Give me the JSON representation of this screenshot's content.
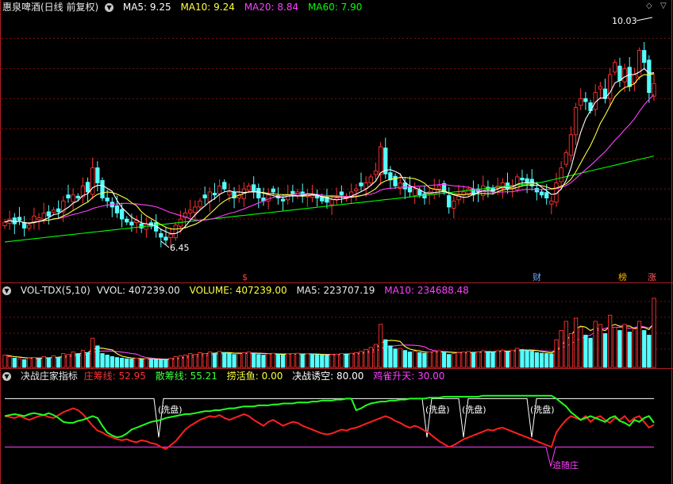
{
  "header": {
    "title": "惠泉啤酒(日线 前复权)",
    "ma5": "MA5: 9.25",
    "ma10": "MA10: 9.24",
    "ma20": "MA20: 8.84",
    "ma60": "MA60: 7.90",
    "price_high": "10.03",
    "price_low": "6.45"
  },
  "volume_header": {
    "name": "VOL-TDX(5,10)",
    "vvol": "VVOL: 407239.00",
    "volume": "VOLUME: 407239.00",
    "ma5": "MA5: 223707.19",
    "ma10": "MA10: 234688.48"
  },
  "indicator_header": {
    "name": "决战庄家指标",
    "zhuang": "庄筹线: 52.95",
    "san": "散筹线: 55.21",
    "lao": "捞活鱼: 0.00",
    "kong": "决战诱空: 80.00",
    "que": "鸡雀升天: 30.00"
  },
  "markers": {
    "dollar": "$",
    "cai": "财",
    "bang": "榜",
    "zhang": "涨"
  },
  "indicator_labels": {
    "xian": "(洗盘)",
    "zhui": "追随庄"
  },
  "colors": {
    "up": "#ff3232",
    "down": "#54ffff",
    "ma5": "#ffffff",
    "ma10": "#ffff40",
    "ma20": "#ff40ff",
    "ma60": "#00ff00",
    "grid": "#7a1010"
  },
  "chart_data": [
    {
      "type": "candlestick",
      "title": "惠泉啤酒(日线 前复权)",
      "ylim": [
        6.0,
        10.4
      ],
      "annotations": {
        "high": 10.03,
        "low": 6.45
      },
      "series": [
        {
          "name": "MA5",
          "value": 9.25
        },
        {
          "name": "MA10",
          "value": 9.24
        },
        {
          "name": "MA20",
          "value": 8.84
        },
        {
          "name": "MA60",
          "value": 7.9
        }
      ],
      "close": [
        6.95,
        7.0,
        6.92,
        6.98,
        6.85,
        6.9,
        7.05,
        7.02,
        7.1,
        7.05,
        7.15,
        7.12,
        7.3,
        7.35,
        7.4,
        7.35,
        7.55,
        7.45,
        7.85,
        7.6,
        7.35,
        7.3,
        7.2,
        7.1,
        7.0,
        6.95,
        6.9,
        6.98,
        6.85,
        6.92,
        6.88,
        6.8,
        6.7,
        6.65,
        6.75,
        6.9,
        7.0,
        7.1,
        7.15,
        7.2,
        7.3,
        7.35,
        7.45,
        7.4,
        7.55,
        7.5,
        7.45,
        7.35,
        7.4,
        7.5,
        7.55,
        7.45,
        7.35,
        7.3,
        7.4,
        7.45,
        7.35,
        7.3,
        7.4,
        7.42,
        7.45,
        7.38,
        7.42,
        7.4,
        7.35,
        7.3,
        7.28,
        7.32,
        7.35,
        7.4,
        7.38,
        7.45,
        7.5,
        7.55,
        7.6,
        7.7,
        7.8,
        8.2,
        7.75,
        7.65,
        7.55,
        7.6,
        7.5,
        7.45,
        7.5,
        7.4,
        7.35,
        7.45,
        7.5,
        7.55,
        7.45,
        7.2,
        7.3,
        7.4,
        7.45,
        7.5,
        7.4,
        7.45,
        7.55,
        7.5,
        7.45,
        7.55,
        7.6,
        7.5,
        7.55,
        7.7,
        7.65,
        7.6,
        7.55,
        7.45,
        7.4,
        7.35,
        7.3,
        7.6,
        7.85,
        8.1,
        8.4,
        8.85,
        9.0,
        8.95,
        8.8,
        9.1,
        9.2,
        9.0,
        9.4,
        9.6,
        9.3,
        9.5,
        9.2,
        9.4,
        9.8,
        9.6,
        9.1,
        9.25
      ],
      "volume": [
        40,
        35,
        30,
        28,
        25,
        30,
        32,
        28,
        35,
        30,
        38,
        33,
        45,
        42,
        50,
        45,
        55,
        48,
        95,
        70,
        45,
        40,
        35,
        32,
        30,
        28,
        27,
        30,
        26,
        28,
        27,
        25,
        24,
        26,
        30,
        35,
        38,
        40,
        45,
        42,
        48,
        45,
        50,
        46,
        52,
        48,
        45,
        42,
        44,
        48,
        50,
        46,
        42,
        40,
        44,
        46,
        42,
        40,
        44,
        45,
        46,
        42,
        44,
        43,
        41,
        40,
        39,
        42,
        43,
        45,
        44,
        46,
        48,
        52,
        58,
        65,
        75,
        140,
        90,
        70,
        60,
        62,
        55,
        50,
        52,
        48,
        46,
        50,
        52,
        54,
        50,
        42,
        45,
        48,
        50,
        52,
        48,
        50,
        54,
        52,
        50,
        54,
        56,
        52,
        55,
        62,
        58,
        55,
        52,
        48,
        46,
        45,
        44,
        90,
        120,
        150,
        110,
        160,
        130,
        105,
        95,
        150,
        140,
        110,
        170,
        130,
        120,
        140,
        115,
        125,
        150,
        120,
        105,
        225
      ],
      "volume_ylim": [
        0,
        230
      ],
      "volume_stats": {
        "VVOL": 407239.0,
        "VOLUME": 407239.0,
        "MA5": 223707.19,
        "MA10": 234688.48
      }
    },
    {
      "type": "line",
      "title": "决战庄家指标",
      "ylim": [
        0,
        100
      ],
      "series": [
        {
          "name": "庄筹线",
          "last": 52.95,
          "values": [
            62,
            61,
            60,
            62,
            60,
            58,
            60,
            62,
            63,
            61,
            60,
            63,
            66,
            68,
            70,
            68,
            64,
            58,
            52,
            47,
            45,
            42,
            40,
            38,
            37,
            38,
            36,
            35,
            37,
            36,
            34,
            33,
            30,
            28,
            32,
            36,
            42,
            48,
            52,
            55,
            58,
            60,
            62,
            61,
            63,
            60,
            58,
            60,
            62,
            64,
            62,
            58,
            55,
            52,
            56,
            58,
            55,
            52,
            54,
            56,
            55,
            52,
            50,
            48,
            46,
            44,
            43,
            44,
            46,
            48,
            47,
            49,
            50,
            52,
            54,
            56,
            58,
            60,
            62,
            60,
            57,
            55,
            52,
            50,
            52,
            50,
            47,
            44,
            40,
            36,
            33,
            30,
            32,
            35,
            38,
            40,
            42,
            44,
            46,
            48,
            47,
            49,
            50,
            48,
            46,
            44,
            42,
            40,
            38,
            36,
            34,
            32,
            30,
            45,
            52,
            58,
            62,
            60,
            58,
            62,
            56,
            60,
            62,
            58,
            55,
            60,
            58,
            62,
            56,
            60,
            62,
            56,
            50,
            53
          ]
        },
        {
          "name": "散筹线",
          "last": 55.21,
          "values": [
            62,
            63,
            64,
            63,
            62,
            64,
            65,
            64,
            63,
            65,
            63,
            60,
            56,
            55,
            55,
            57,
            58,
            60,
            62,
            60,
            52,
            45,
            42,
            40,
            41,
            44,
            48,
            50,
            52,
            54,
            56,
            57,
            58,
            60,
            61,
            62,
            63,
            64,
            64,
            65,
            66,
            67,
            67,
            68,
            68,
            69,
            70,
            70,
            71,
            72,
            72,
            72,
            73,
            73,
            73,
            74,
            74,
            75,
            75,
            75,
            76,
            76,
            76,
            77,
            77,
            78,
            78,
            78,
            79,
            79,
            80,
            80,
            68,
            70,
            73,
            75,
            76,
            77,
            77,
            78,
            78,
            79,
            79,
            80,
            80,
            80,
            80,
            81,
            81,
            81,
            82,
            82,
            82,
            82,
            82,
            82,
            82,
            82,
            83,
            83,
            83,
            83,
            83,
            83,
            83,
            83,
            83,
            83,
            83,
            83,
            83,
            83,
            83,
            80,
            76,
            72,
            66,
            62,
            58,
            60,
            62,
            60,
            58,
            56,
            60,
            62,
            57,
            55,
            52,
            58,
            56,
            60,
            62,
            55
          ]
        },
        {
          "name": "捞活鱼",
          "last": 0.0
        },
        {
          "name": "决战诱空",
          "value": 80.0
        },
        {
          "name": "鸡雀升天",
          "value": 30.0
        }
      ]
    }
  ]
}
